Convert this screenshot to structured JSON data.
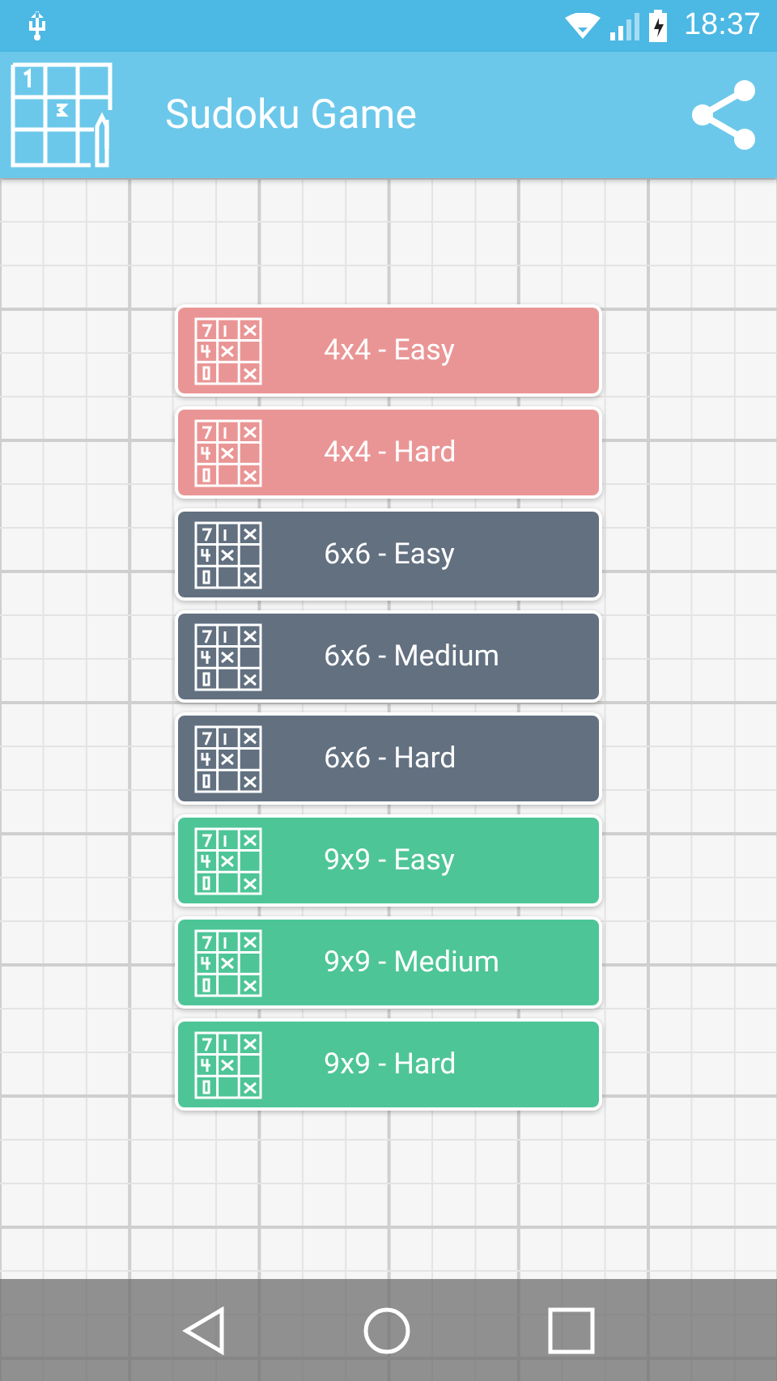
{
  "status_bar": {
    "time": "18:37"
  },
  "app_bar": {
    "title": "Sudoku Game"
  },
  "levels": [
    {
      "label": "4x4 - Easy",
      "color": "#ea9595"
    },
    {
      "label": "4x4 - Hard",
      "color": "#ea9595"
    },
    {
      "label": "6x6 - Easy",
      "color": "#627080"
    },
    {
      "label": "6x6 - Medium",
      "color": "#627080"
    },
    {
      "label": "6x6 - Hard",
      "color": "#627080"
    },
    {
      "label": "9x9 - Easy",
      "color": "#4ec597"
    },
    {
      "label": "9x9 - Medium",
      "color": "#4ec597"
    },
    {
      "label": "9x9 - Hard",
      "color": "#4ec597"
    }
  ]
}
